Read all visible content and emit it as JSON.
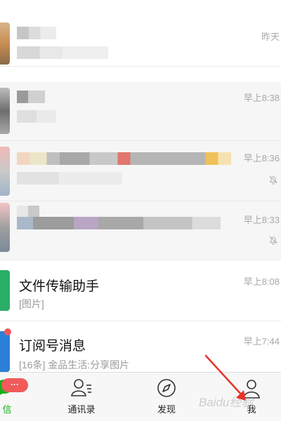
{
  "chats": [
    {
      "time": "昨天"
    },
    {
      "time": "早上8:38"
    },
    {
      "time": "早上8:36",
      "muted": true
    },
    {
      "time": "早上8:33",
      "muted": true
    },
    {
      "title": "文件传输助手",
      "preview": "[图片]",
      "time": "早上8:08",
      "avatar_color": "#2aae67"
    },
    {
      "title": "订阅号消息",
      "preview": "[16条] 金品生活:分享图片",
      "time": "早上7:44",
      "avatar_color": "#2c7fd6"
    }
  ],
  "tabbar": {
    "tabs": [
      {
        "label": "信",
        "icon": "chat-bubble-icon",
        "badge": "···",
        "active": true
      },
      {
        "label": "通讯录",
        "icon": "contacts-icon"
      },
      {
        "label": "发现",
        "icon": "compass-icon"
      },
      {
        "label": "我",
        "icon": "person-icon"
      }
    ]
  },
  "colors": {
    "accent_green": "#1aad19",
    "badge_red": "#f05a5a",
    "annotation_arrow": "#e8332a"
  },
  "watermark": "Baidu经验"
}
